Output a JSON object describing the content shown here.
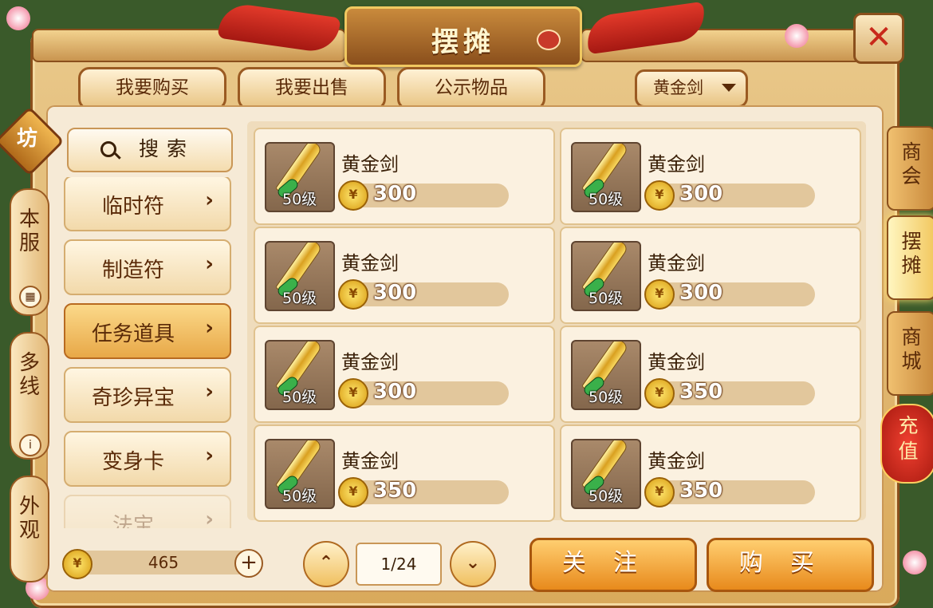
{
  "window": {
    "title": "摆摊",
    "close_symbol": "✕"
  },
  "top_tabs": [
    {
      "label": "我要购买"
    },
    {
      "label": "我要出售"
    },
    {
      "label": "公示物品"
    }
  ],
  "filter": {
    "selected": "黄金剑"
  },
  "left_tabs": {
    "badge": "坊",
    "items": [
      {
        "label": "本服",
        "mini": "▦"
      },
      {
        "label": "多线",
        "mini": "i"
      },
      {
        "label": "外观",
        "mini": ""
      }
    ]
  },
  "right_tabs": [
    {
      "label": "商会",
      "active": false
    },
    {
      "label": "摆摊",
      "active": true
    },
    {
      "label": "商城",
      "active": false
    }
  ],
  "recharge": {
    "label": "充值"
  },
  "search": {
    "label": "搜索"
  },
  "categories": [
    {
      "label": "临时符",
      "active": false
    },
    {
      "label": "制造符",
      "active": false
    },
    {
      "label": "任务道具",
      "active": true
    },
    {
      "label": "奇珍异宝",
      "active": false
    },
    {
      "label": "变身卡",
      "active": false
    },
    {
      "label": "法宝",
      "active": false
    }
  ],
  "arrow_symbol": "›",
  "listings": [
    {
      "name": "黄金剑",
      "level": "50级",
      "price": "300"
    },
    {
      "name": "黄金剑",
      "level": "50级",
      "price": "300"
    },
    {
      "name": "黄金剑",
      "level": "50级",
      "price": "300"
    },
    {
      "name": "黄金剑",
      "level": "50级",
      "price": "300"
    },
    {
      "name": "黄金剑",
      "level": "50级",
      "price": "300"
    },
    {
      "name": "黄金剑",
      "level": "50级",
      "price": "350"
    },
    {
      "name": "黄金剑",
      "level": "50级",
      "price": "350"
    },
    {
      "name": "黄金剑",
      "level": "50级",
      "price": "350"
    }
  ],
  "balance": {
    "amount": "465",
    "plus": "+"
  },
  "pagination": {
    "current": "1/24",
    "up": "⌃",
    "down": "⌄"
  },
  "actions": {
    "follow": "关注",
    "buy": "购买"
  },
  "colors": {
    "accent": "#e88a1c",
    "frame": "#8a4f1c",
    "panel": "#f6ead6",
    "active_tab": "#f2c860"
  }
}
